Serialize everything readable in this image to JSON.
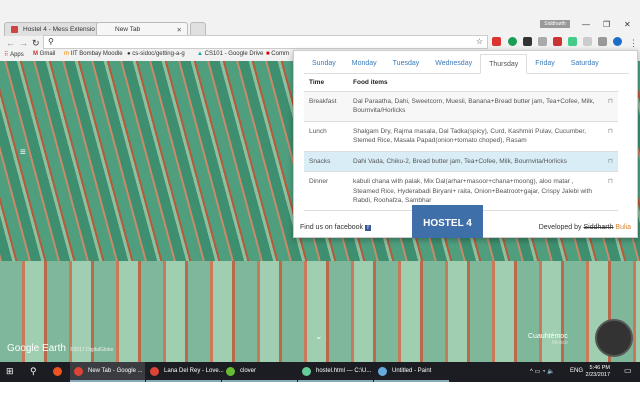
{
  "browser": {
    "tabs": [
      {
        "label": "Hostel 4 - Mess Extensio"
      },
      {
        "label": "New Tab"
      }
    ],
    "profile": "Siddharth",
    "omnibox_value": "",
    "bookmarks": [
      "Apps",
      "Gmail",
      "IIT Bombay Moodle",
      "cs-sidoc/getting-a-g",
      "CS101 - Google Drive",
      "Comm"
    ],
    "window_controls": [
      "—",
      "❐",
      "✕"
    ]
  },
  "earth": {
    "brand": "Google Earth",
    "credit": "©2017 DigitalGlobe",
    "place": "Cuauhtémoc",
    "region": "Mexico"
  },
  "popup": {
    "days": [
      "Sunday",
      "Monday",
      "Tuesday",
      "Wednesday",
      "Thursday",
      "Friday",
      "Saturday"
    ],
    "active_day": "Thursday",
    "headers": {
      "time": "Time",
      "food": "Food items"
    },
    "meals": [
      {
        "time": "Breakfast",
        "items": "Dal Paraatha, Dahi, Sweetcorn, Muesli, Banana+Bread butter jam, Tea+Cofee, Milk, Bournvita/Horlicks"
      },
      {
        "time": "Lunch",
        "items": "Shalgam Dry, Rajma masala, Dal Tadka(spicy), Curd, Kashmiri Pulav, Cucumber, Stemed Rice, Masala Papad(onion+tomato choped), Rasam"
      },
      {
        "time": "Snacks",
        "items": "Dahi Vada, Chiku-2, Bread butter jam, Tea+Cofee, Milk, Bournvita/Horlicks"
      },
      {
        "time": "Dinner",
        "items": "kabuli chana with palak, Mix Dal(arhar+masoor+chana+moong), aloo matar , Steamed Rice, Hyderabadi Biryani+ raita, Onion+Beatroot+gajar, Crispy Jalebi with Rabdi, Roohafza, Sambhar"
      }
    ],
    "footer": {
      "facebook": "Find us on facebook",
      "logo": "HOSTEL 4",
      "developed_by": "Developed by",
      "dev_first": "Siddharth",
      "dev_last": "Bulia"
    }
  },
  "taskbar": {
    "items": [
      "New Tab - Google ...",
      "Lana Del Rey - Love...",
      "clover",
      "hostel.html — C:\\U...",
      "Untitled - Paint"
    ],
    "lang": "ENG",
    "time": "5:46 PM",
    "date": "2/23/2017"
  }
}
